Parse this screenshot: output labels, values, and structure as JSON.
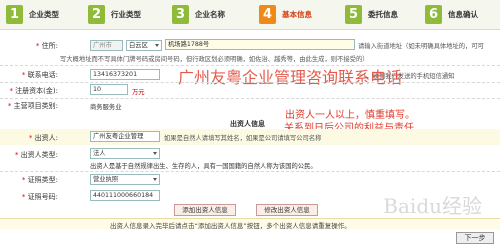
{
  "steps": [
    {
      "num": "1",
      "label": "企业类型"
    },
    {
      "num": "2",
      "label": "行业类型"
    },
    {
      "num": "3",
      "label": "企业名称"
    },
    {
      "num": "4",
      "label": "基本信息"
    },
    {
      "num": "5",
      "label": "委托信息"
    },
    {
      "num": "6",
      "label": "信息确认"
    }
  ],
  "form": {
    "address_label": "住所:",
    "address_city": "广州市",
    "address_district": "白云区",
    "address_detail": "机场路1788号",
    "address_hint1": "请输入街道地址（如未明确具体地址的，可可",
    "address_hint2": "写大概地址而不写具体门牌号码或房间号码，但行政区划必须明确，如佐治、越秀等，由此生成，则不接受的）",
    "phone_label": "联系电话:",
    "phone_value": "13416373201",
    "phone_hint": "（，收到我们发送的手机短信通知",
    "capital_label": "注册资本(金):",
    "capital_value": "10",
    "capital_unit": "万元",
    "business_label": "主营项目类别:",
    "business_value": "商务服务业",
    "investor_section": "出资人信息",
    "investor_label": "出资人:",
    "investor_value": "广州友粤企业管理",
    "investor_hint": "如果是自然人请填写其姓名，如果是公司请填写公司名称",
    "investor_type_label": "出资人类型:",
    "investor_type_value": "法人",
    "investor_type_note": "出资人是基于自然规律出生、生存的人，具有一国国籍的自然人称为该国的公民。",
    "cert_type_label": "证照类型:",
    "cert_type_value": "营业执照",
    "cert_no_label": "证照号码:",
    "cert_no_value": "440111000660184",
    "add_button": "添加出资人信息",
    "edit_button": "修改出资人信息",
    "note": "出资人信息录入完毕后请点击“添加出资人信息”按钮，多个出资人信息请重复操作。",
    "next_button": "下一步"
  },
  "overlay": {
    "watermark": "广州友粤企业管理咨询联系电话",
    "annotation1": "出资人一人以上，慎重填写。",
    "annotation2": "关系到日后公司的利益与责任"
  },
  "baidu_watermark": "Baidu经验",
  "colors": {
    "step_done": "#8fba3a",
    "step_active": "#f08a16",
    "annotation": "#e03a2a"
  }
}
